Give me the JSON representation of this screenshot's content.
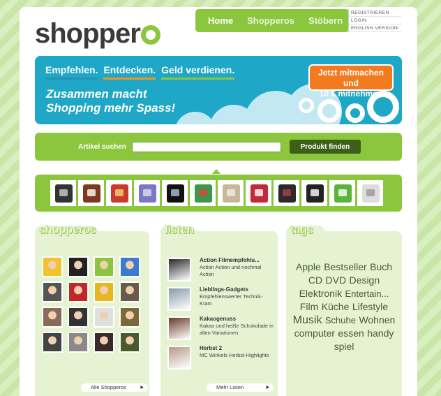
{
  "header": {
    "logo_text": "shopper",
    "nav": [
      {
        "label": "Home",
        "active": true
      },
      {
        "label": "Shopperos",
        "active": false
      },
      {
        "label": "Stöbern",
        "active": false
      }
    ],
    "utility_links": [
      "REGISTRIEREN",
      "LOGIN",
      "ENGLISH VERSION"
    ]
  },
  "banner": {
    "taglines": [
      "Empfehlen.",
      "Entdecken.",
      "Geld verdienen."
    ],
    "headline_line1": "Zusammen macht",
    "headline_line2": "Shopping mehr Spass!",
    "cta_line1": "Jetzt mitmachen und",
    "cta_line2": "10 € mitnehmen"
  },
  "search": {
    "label": "Artikel suchen",
    "input_value": "",
    "button_label": "Produkt finden"
  },
  "products": [
    {
      "color": "#333333",
      "accent": "#cccccc"
    },
    {
      "color": "#7a3a1e",
      "accent": "#ffffff"
    },
    {
      "color": "#c93a2c",
      "accent": "#f3d37a"
    },
    {
      "color": "#7a7ac4",
      "accent": "#e0e0f0"
    },
    {
      "color": "#111111",
      "accent": "#aac4e0"
    },
    {
      "color": "#3a9a4a",
      "accent": "#e04040"
    },
    {
      "color": "#c8b89a",
      "accent": "#eeeeee"
    },
    {
      "color": "#c02a3a",
      "accent": "#ffffff"
    },
    {
      "color": "#2a2a2a",
      "accent": "#b04040"
    },
    {
      "color": "#222222",
      "accent": "#ffffff"
    },
    {
      "color": "#5ab43a",
      "accent": "#ffffff"
    },
    {
      "color": "#dddddd",
      "accent": "#999999"
    }
  ],
  "shopperos": {
    "title": "shopperos",
    "avatars": [
      "#f2c230",
      "#222222",
      "#8cc63f",
      "#3a7acf",
      "#555555",
      "#c0262a",
      "#e6b820",
      "#6a5a4a",
      "#8a6a5a",
      "#333333",
      "#e0e0e0",
      "#7a6a3a",
      "#444444",
      "#8a8a8a",
      "#3a2a2a",
      "#4a5a2a"
    ],
    "button_label": "Alle Shopperos"
  },
  "listen": {
    "title": "listen",
    "items": [
      {
        "title": "Action Filmempfehlu...",
        "desc": "Action Action und nochmal Action",
        "color": "#2a2a2a"
      },
      {
        "title": "Lieblings-Gadgets",
        "desc": "Empfehlenswerter Technik-Kram",
        "color": "#8a9aaa"
      },
      {
        "title": "Kakaogenuss",
        "desc": "Kakao und heiße Schokolade in allen Variationen",
        "color": "#6a3a2a"
      },
      {
        "title": "Herbst 2",
        "desc": "MC Winkels Herbst-Highlights",
        "color": "#b89a8a"
      }
    ],
    "button_label": "Mehr Listen"
  },
  "tags": {
    "title": "tags",
    "items": [
      {
        "label": "Apple",
        "size": 14
      },
      {
        "label": "Bestseller",
        "size": 14
      },
      {
        "label": "Buch",
        "size": 14
      },
      {
        "label": "CD",
        "size": 14
      },
      {
        "label": "DVD",
        "size": 14
      },
      {
        "label": "Design",
        "size": 14
      },
      {
        "label": "Elektronik",
        "size": 14
      },
      {
        "label": "Entertain...",
        "size": 13
      },
      {
        "label": "Film",
        "size": 14
      },
      {
        "label": "Küche",
        "size": 14
      },
      {
        "label": "Lifestyle",
        "size": 14
      },
      {
        "label": "Musik",
        "size": 16
      },
      {
        "label": "Schuhe",
        "size": 13
      },
      {
        "label": "Wohnen",
        "size": 14
      },
      {
        "label": "computer",
        "size": 14
      },
      {
        "label": "essen",
        "size": 14
      },
      {
        "label": "handy",
        "size": 14
      },
      {
        "label": "spiel",
        "size": 14
      }
    ]
  }
}
